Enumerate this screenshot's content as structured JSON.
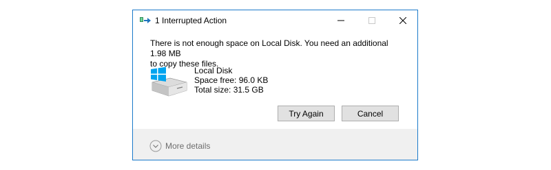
{
  "window": {
    "title": "1 Interrupted Action"
  },
  "message": {
    "line1": "There is not enough space on Local Disk. You need an additional 1.98 MB",
    "line2": "to copy these files."
  },
  "disk": {
    "name": "Local Disk",
    "space_free": "Space free: 96.0 KB",
    "total_size": "Total size: 31.5 GB",
    "icon": "drive-windows-icon"
  },
  "buttons": {
    "try_again": "Try Again",
    "cancel": "Cancel"
  },
  "footer": {
    "more_details": "More details"
  },
  "colors": {
    "window_border": "#1979ca",
    "button_bg": "#e1e1e1",
    "button_border": "#adadad",
    "footer_bg": "#f0f0f0",
    "windows_logo": "#00a4ef"
  }
}
